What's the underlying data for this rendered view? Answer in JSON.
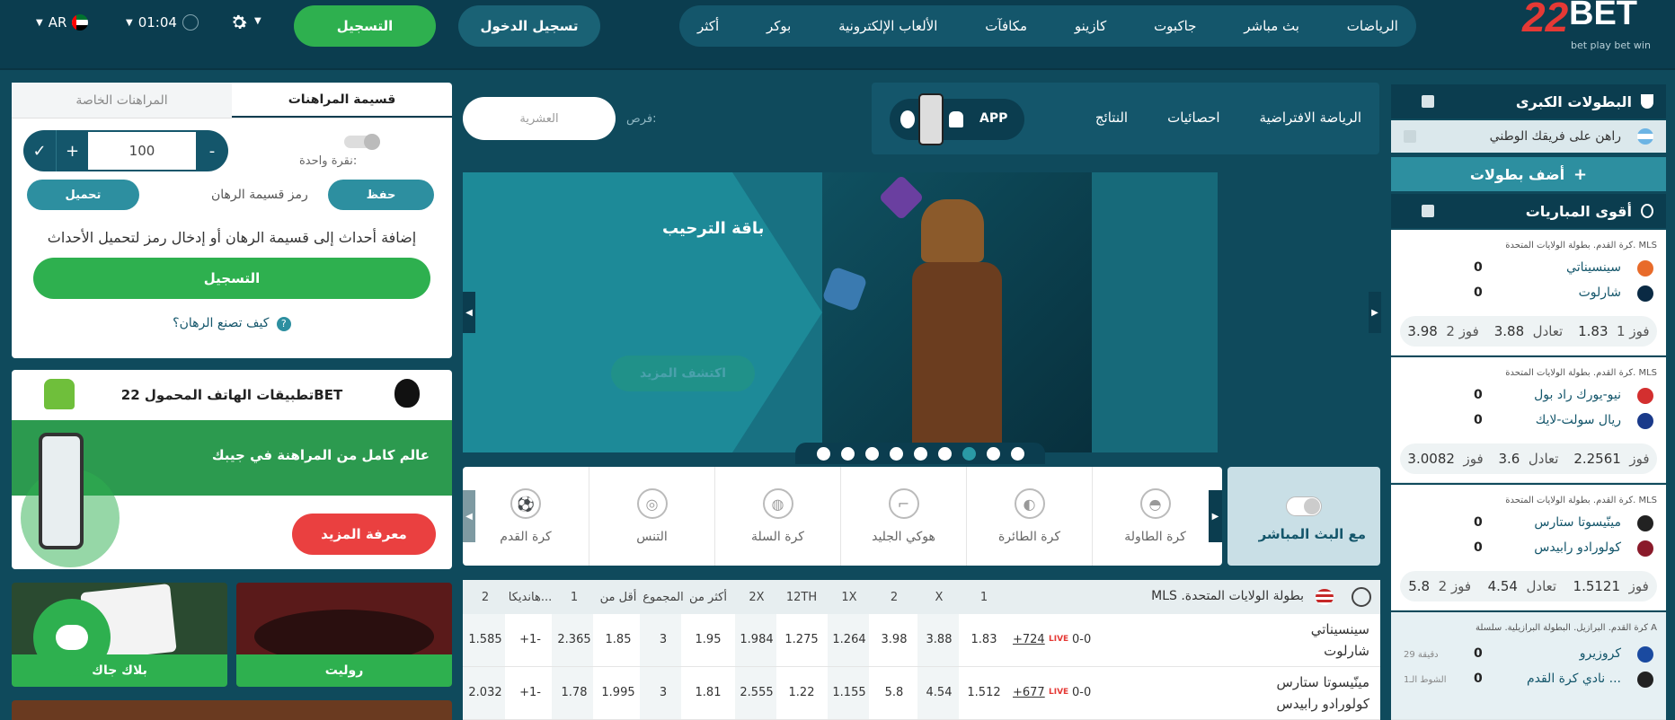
{
  "header": {
    "logo_number": "22",
    "logo_word": "BET",
    "logo_tagline": "bet play bet win",
    "nav": [
      "الرياضات",
      "بث مباشر",
      "جاكبوت",
      "كازينو",
      "مكافآت",
      "الألعاب الإلكترونية",
      "بوكر",
      "أكثر"
    ],
    "login_label": "تسجيل الدخول",
    "register_label": "التسجيل",
    "time": "01:04",
    "language": "AR"
  },
  "betslip": {
    "tab_betslip": "قسيمة المراهنات",
    "tab_my_bets": "المراهنات الخاصة",
    "stake_value": "100",
    "minus": "-",
    "plus": "+",
    "one_click": "نقرة واحدة:",
    "save_label": "حفظ",
    "code_label": "رمز قسيمة الرهان",
    "load_label": "تحميل",
    "message": "إضافة أحداث إلى قسيمة الرهان أو إدخال رمز لتحميل الأحداث",
    "register_label": "التسجيل",
    "howto_label": "كيف تصنع الرهان؟"
  },
  "apps_card": {
    "title": "تطبيقات الهاتف المحمول 22BET",
    "tagline": "عالم كامل من المراهنة في جيبك",
    "more_label": "معرفة المزيد"
  },
  "tiles": {
    "roulette": "روليت",
    "blackjack": "بلاك جاك"
  },
  "subnav": {
    "items": [
      "الرياضة الافتراضية",
      "احصائيات",
      "النتائج"
    ],
    "app_label": "APP",
    "chance_label": "فرص:",
    "search_placeholder": "العشرية"
  },
  "banner": {
    "title": "باقة الترحيب",
    "cta": "اكتشف المزيد",
    "dots": 9,
    "active_dot": 7
  },
  "sports": {
    "live_label": "مع البث المباشر",
    "items": [
      "كرة الطاولة",
      "كرة الطائرة",
      "هوكي الجليد",
      "كرة السلة",
      "التنس",
      "كرة القدم"
    ]
  },
  "table": {
    "league": "MLS .بطولة الولايات المتحدة",
    "headers": [
      "1",
      "X",
      "2",
      "1X",
      "12TH",
      "2X",
      "أكثر من",
      "المجموع",
      "أقل من",
      "1",
      "هانديكا...",
      "2"
    ],
    "rows": [
      {
        "team1": "سينسيناتي",
        "team2": "شارلوت",
        "score": "0-0",
        "live": "LIVE",
        "more": "+724",
        "odds": [
          "1.83",
          "3.88",
          "3.98",
          "1.264",
          "1.275",
          "1.984",
          "1.95",
          "3",
          "1.85",
          "2.365",
          "+1-",
          "1.585"
        ]
      },
      {
        "team1": "مينّيسوتا ستارس",
        "team2": "كولورادو رابيدس",
        "score": "0-0",
        "live": "LIVE",
        "more": "+677",
        "odds": [
          "1.512",
          "4.54",
          "5.8",
          "1.155",
          "1.22",
          "2.555",
          "1.81",
          "3",
          "1.995",
          "1.78",
          "+1-",
          "2.032"
        ]
      }
    ]
  },
  "right": {
    "top_title": "البطولات الكبرى",
    "fav_label": "راهن على فريقك الوطني",
    "add_label": "أضف بطولات",
    "strongest_title": "أقوى المباريات",
    "matches": [
      {
        "league": "كرة القدم. بطولة الولايات المتحدة. MLS",
        "team1": "سينسيناتي",
        "team2": "شارلوت",
        "s1": "0",
        "s2": "0",
        "w1l": "فوز 1",
        "w1": "1.83",
        "xl": "تعادل",
        "x": "3.88",
        "w2l": "فوز 2",
        "w2": "3.98"
      },
      {
        "league": "كرة القدم. بطولة الولايات المتحدة. MLS",
        "team1": "نيو-يورك راد بول",
        "team2": "ريال سولت-لايك",
        "s1": "0",
        "s2": "0",
        "w1l": "فوز",
        "w1": "2.2561",
        "xl": "تعادل",
        "x": "3.6",
        "w2l": "فوز",
        "w2": "3.0082"
      },
      {
        "league": "كرة القدم. بطولة الولايات المتحدة. MLS",
        "team1": "مينّيسوتا ستارس",
        "team2": "كولورادو رابيدس",
        "s1": "0",
        "s2": "0",
        "w1l": "فوز",
        "w1": "1.5121",
        "xl": "تعادل",
        "x": "4.54",
        "w2l": "فوز 2",
        "w2": "5.8"
      },
      {
        "league": "كرة القدم. البرازيل. البطولة البرازيلية. سلسلة A",
        "team1": "كروزيرو",
        "team2": "نادي كرة القدم ...",
        "s1": "0",
        "s2": "0",
        "minute": "29 دقيقة",
        "half": "الشوط الـ1"
      }
    ]
  }
}
